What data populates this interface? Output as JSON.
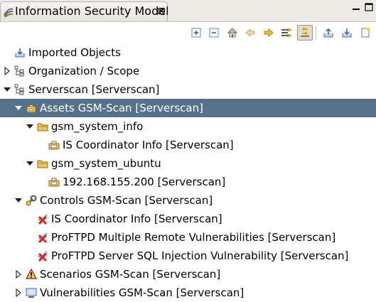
{
  "view": {
    "title": "Information Security Model",
    "close_glyph": "⊠"
  },
  "toolbar": {
    "buttons": [
      {
        "icon": "expand-all-icon"
      },
      {
        "icon": "collapse-all-icon"
      },
      {
        "icon": "home-icon"
      },
      {
        "icon": "back-arrow-icon"
      },
      {
        "icon": "forward-arrow-icon"
      },
      {
        "icon": "filter-icon"
      },
      {
        "icon": "link-with-editor-icon",
        "active": true
      },
      {
        "icon": "export-icon"
      },
      {
        "icon": "import-icon"
      },
      {
        "icon": "new-document-icon"
      }
    ]
  },
  "tree": {
    "imported": "Imported Objects",
    "organization": "Organization / Scope",
    "serverscan": "Serverscan [Serverscan]",
    "assets": "Assets GSM-Scan [Serverscan]",
    "gsm_system_info": "gsm_system_info",
    "is_coordinator_asset": "IS Coordinator Info [Serverscan]",
    "gsm_system_ubuntu": "gsm_system_ubuntu",
    "ip_asset": "192.168.155.200 [Serverscan]",
    "controls": "Controls GSM-Scan [Serverscan]",
    "control_1": "IS Coordinator Info [Serverscan]",
    "control_2": "ProFTPD Multiple Remote Vulnerabilities [Serverscan]",
    "control_3": "ProFTPD Server SQL Injection Vulnerability [Serverscan]",
    "scenarios": "Scenarios GSM-Scan [Serverscan]",
    "vulnerabilities": "Vulnerabilities GSM-Scan [Serverscan]"
  },
  "colors": {
    "selection": "#56728b",
    "folder": "#e2a64a",
    "control_error": "#d8261d",
    "arrow": "#e8b020"
  }
}
